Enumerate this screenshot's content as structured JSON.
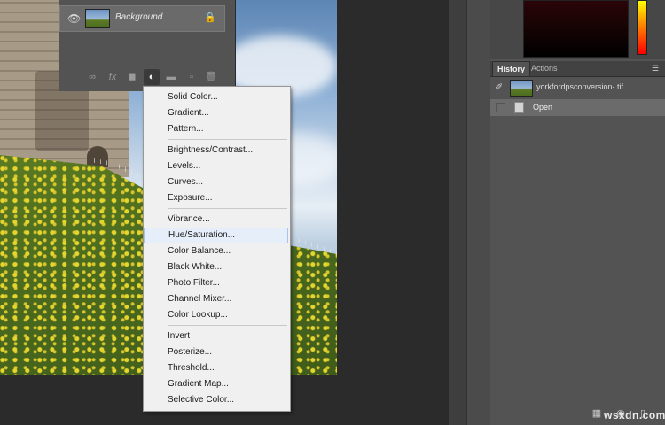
{
  "layers": {
    "layer_name": "Background",
    "icons": {
      "visibility": "eye-icon",
      "lock": "lock-icon"
    },
    "tools": {
      "link": "∞",
      "fx": "fx",
      "mask": "◼",
      "adjustment": "◐",
      "group": "▬",
      "new": "▫",
      "delete": "🗑"
    }
  },
  "adjustment_menu": {
    "groups": [
      [
        "Solid Color...",
        "Gradient...",
        "Pattern..."
      ],
      [
        "Brightness/Contrast...",
        "Levels...",
        "Curves...",
        "Exposure..."
      ],
      [
        "Vibrance...",
        "Hue/Saturation...",
        "Color Balance...",
        "Black  White...",
        "Photo Filter...",
        "Channel Mixer...",
        "Color Lookup..."
      ],
      [
        "Invert",
        "Posterize...",
        "Threshold...",
        "Gradient Map...",
        "Selective Color..."
      ]
    ],
    "highlighted": "Hue/Saturation..."
  },
  "history_panel": {
    "tabs": [
      "History",
      "Actions"
    ],
    "active_tab": "History",
    "snapshot_name": "yorkfordpsconversion-.tif",
    "steps": [
      "Open"
    ]
  },
  "watermark": "wsxdn.com"
}
